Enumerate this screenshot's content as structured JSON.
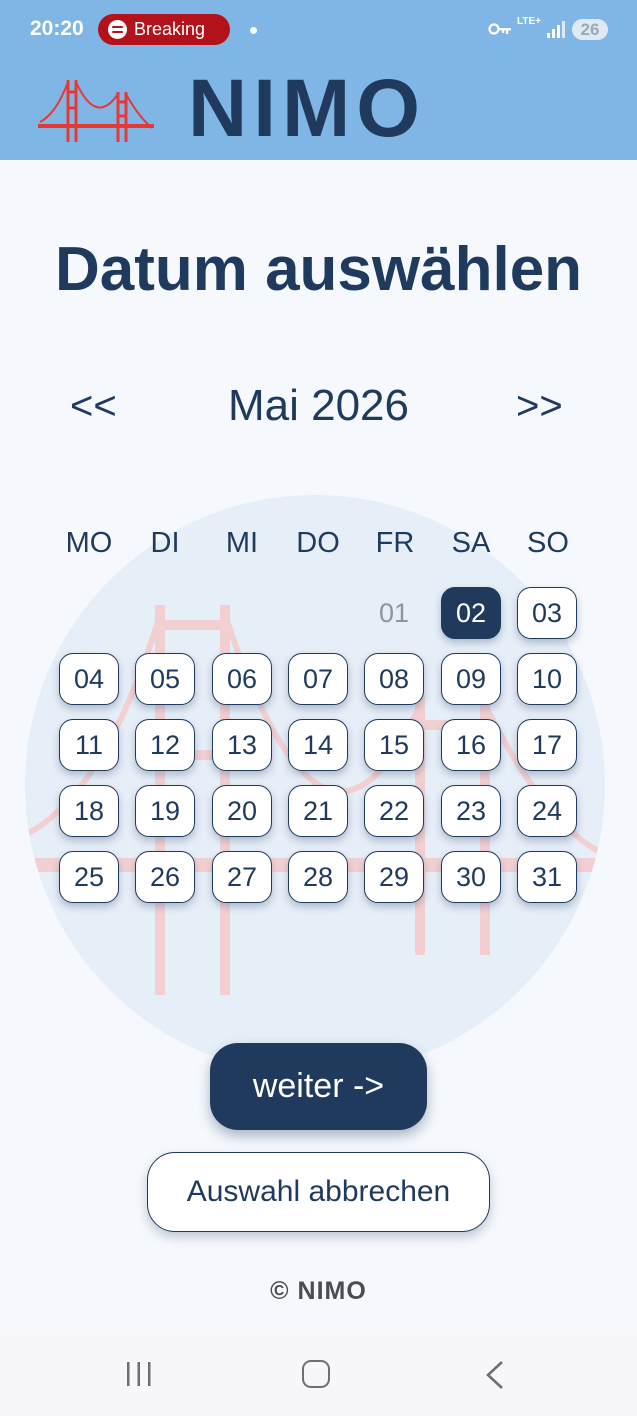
{
  "status_bar": {
    "time": "20:20",
    "media_label": "Breaking",
    "network": "LTE+",
    "battery": "26"
  },
  "header": {
    "brand": "NIMO",
    "logo_icon": "golden-gate-bridge-icon",
    "background_color": "#7fb6e6",
    "brand_color": "#1f3a5c"
  },
  "page": {
    "title": "Datum auswählen"
  },
  "calendar": {
    "prev_label": "<<",
    "next_label": ">>",
    "month_label": "Mai 2026",
    "weekdays": [
      "MO",
      "DI",
      "MI",
      "DO",
      "FR",
      "SA",
      "SO"
    ],
    "selected_day": "02",
    "disabled_days": [
      "01"
    ],
    "days": [
      "01",
      "02",
      "03",
      "04",
      "05",
      "06",
      "07",
      "08",
      "09",
      "10",
      "11",
      "12",
      "13",
      "14",
      "15",
      "16",
      "17",
      "18",
      "19",
      "20",
      "21",
      "22",
      "23",
      "24",
      "25",
      "26",
      "27",
      "28",
      "29",
      "30",
      "31"
    ]
  },
  "actions": {
    "next_label": "weiter ->",
    "cancel_label": "Auswahl abbrechen"
  },
  "footer": {
    "copyright": "© NIMO"
  },
  "colors": {
    "accent": "#1f3a5c",
    "watermark": "#e6eef8",
    "bridge_red": "#e53935"
  }
}
